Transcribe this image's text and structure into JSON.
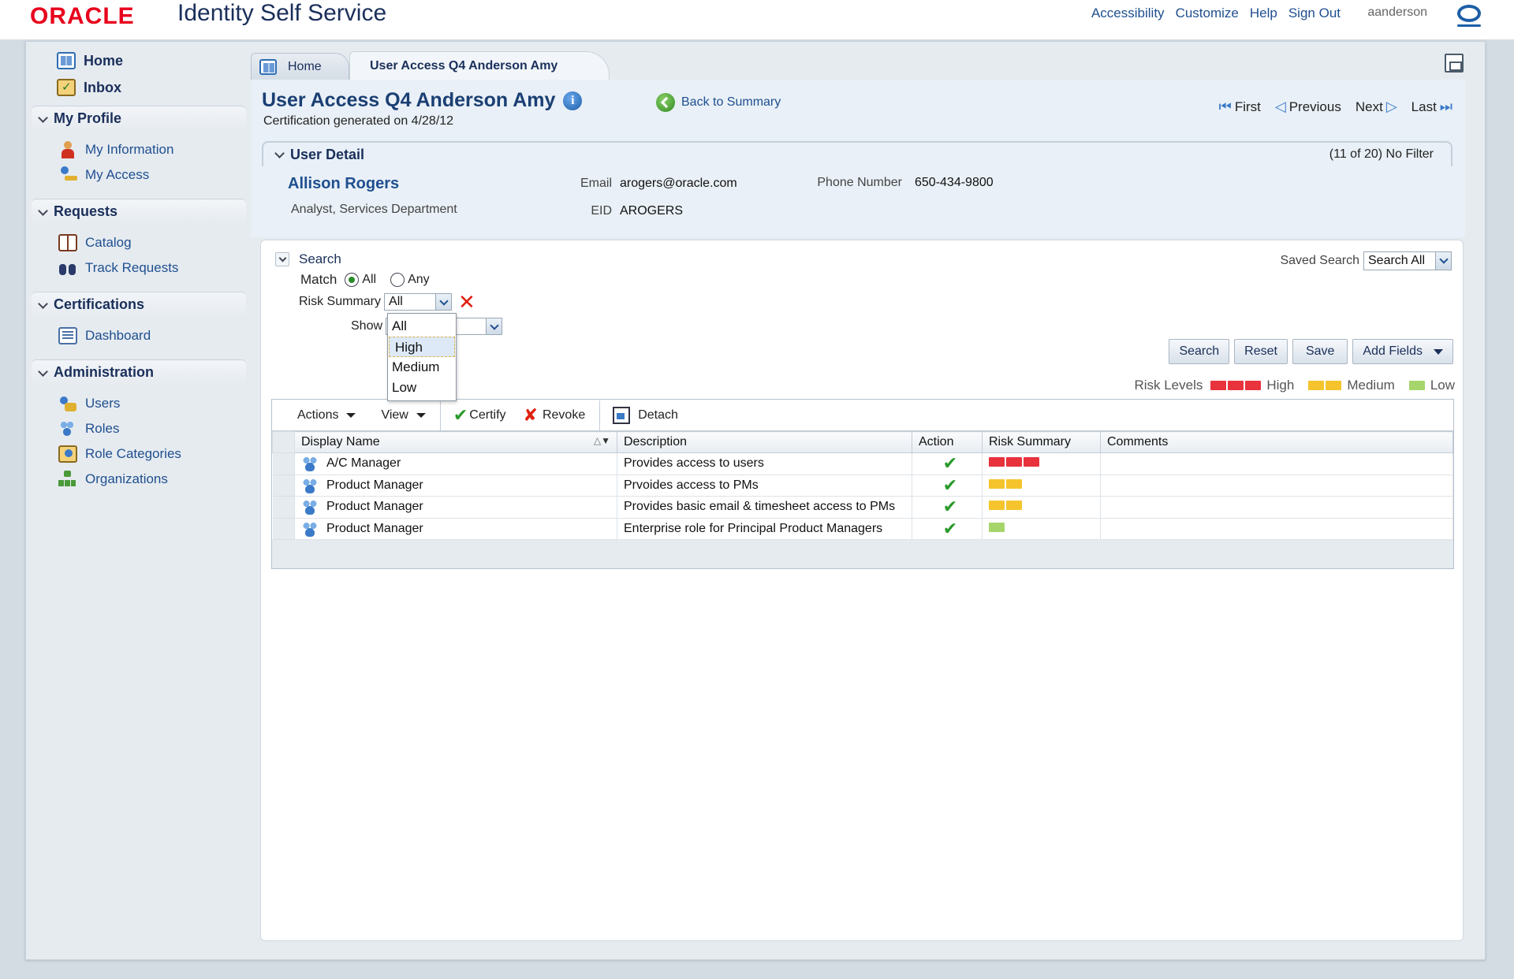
{
  "header": {
    "logo": "ORACLE",
    "app_title": "Identity Self Service",
    "links": [
      "Accessibility",
      "Customize",
      "Help",
      "Sign Out"
    ],
    "username": "aanderson"
  },
  "sidebar": {
    "home": "Home",
    "inbox": "Inbox",
    "sections": [
      {
        "title": "My Profile",
        "items": [
          "My Information",
          "My Access"
        ]
      },
      {
        "title": "Requests",
        "items": [
          "Catalog",
          "Track Requests"
        ]
      },
      {
        "title": "Certifications",
        "items": [
          "Dashboard"
        ]
      },
      {
        "title": "Administration",
        "items": [
          "Users",
          "Roles",
          "Role Categories",
          "Organizations"
        ]
      }
    ]
  },
  "tabs": {
    "home": "Home",
    "active": "User Access Q4 Anderson Amy"
  },
  "page": {
    "title": "User Access Q4 Anderson Amy",
    "generated": "Certification generated on 4/28/12",
    "back_link": "Back to Summary",
    "pager": {
      "first": "First",
      "previous": "Previous",
      "next": "Next",
      "last": "Last"
    }
  },
  "user_detail": {
    "header": "User Detail",
    "count": "(11 of 20) No Filter",
    "name": "Allison Rogers",
    "title": "Analyst, Services Department",
    "email_label": "Email",
    "email": "arogers@oracle.com",
    "eid_label": "EID",
    "eid": "AROGERS",
    "phone_label": "Phone Number",
    "phone": "650-434-9800"
  },
  "search": {
    "label": "Search",
    "saved_search_label": "Saved Search",
    "saved_search_value": "Search All",
    "match_label": "Match",
    "match_all": "All",
    "match_any": "Any",
    "match_selected": "All",
    "risk_label": "Risk Summary",
    "risk_value": "All",
    "show_label": "Show",
    "dropdown_options": [
      "All",
      "High",
      "Medium",
      "Low"
    ],
    "dropdown_highlighted": "High",
    "buttons": {
      "search": "Search",
      "reset": "Reset",
      "save": "Save",
      "add_fields": "Add Fields"
    }
  },
  "risk_legend": {
    "label": "Risk Levels",
    "high": "High",
    "medium": "Medium",
    "low": "Low",
    "colors": {
      "high": "#e8323c",
      "medium": "#f5c42c",
      "low": "#a6d66b"
    }
  },
  "table_toolbar": {
    "actions": "Actions",
    "view": "View",
    "certify": "Certify",
    "revoke": "Revoke",
    "detach": "Detach"
  },
  "table": {
    "columns": [
      "Display Name",
      "Description",
      "Action",
      "Risk Summary",
      "Comments"
    ],
    "rows": [
      {
        "name": "A/C Manager",
        "description": "Provides access to users",
        "action": "certified",
        "risk": "High",
        "comments": ""
      },
      {
        "name": "Product Manager",
        "description": "Prvoides access to PMs",
        "action": "certified",
        "risk": "Medium",
        "comments": ""
      },
      {
        "name": "Product Manager",
        "description": "Provides basic email & timesheet access to PMs",
        "action": "certified",
        "risk": "Medium",
        "comments": ""
      },
      {
        "name": "Product Manager",
        "description": "Enterprise role for Principal Product Managers",
        "action": "certified",
        "risk": "Low",
        "comments": ""
      }
    ]
  }
}
